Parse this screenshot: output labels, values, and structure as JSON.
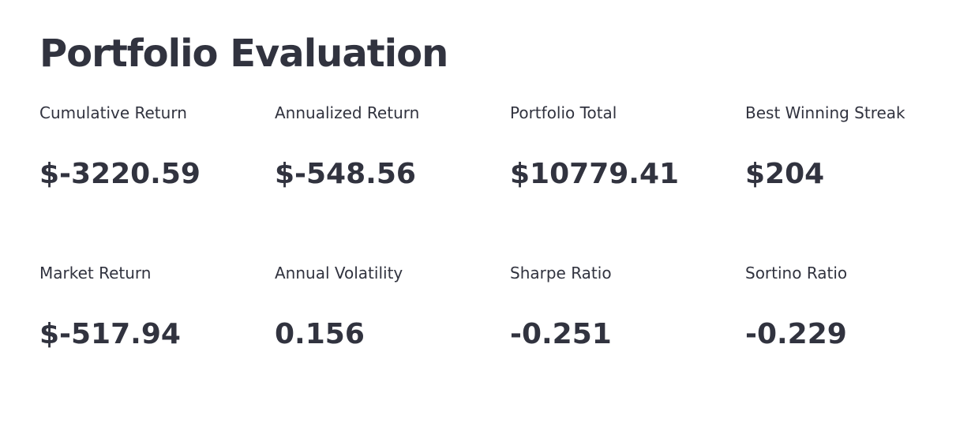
{
  "header": {
    "title": "Portfolio Evaluation"
  },
  "metrics": {
    "row1": [
      {
        "label": "Cumulative Return",
        "value": "$-3220.59"
      },
      {
        "label": "Annualized Return",
        "value": "$-548.56"
      },
      {
        "label": "Portfolio Total",
        "value": "$10779.41"
      },
      {
        "label": "Best Winning Streak",
        "value": "$204"
      }
    ],
    "row2": [
      {
        "label": "Market Return",
        "value": "$-517.94"
      },
      {
        "label": "Annual Volatility",
        "value": "0.156"
      },
      {
        "label": "Sharpe Ratio",
        "value": "-0.251"
      },
      {
        "label": "Sortino Ratio",
        "value": "-0.229"
      }
    ]
  },
  "colors": {
    "text": "#31333f",
    "background": "#ffffff"
  }
}
